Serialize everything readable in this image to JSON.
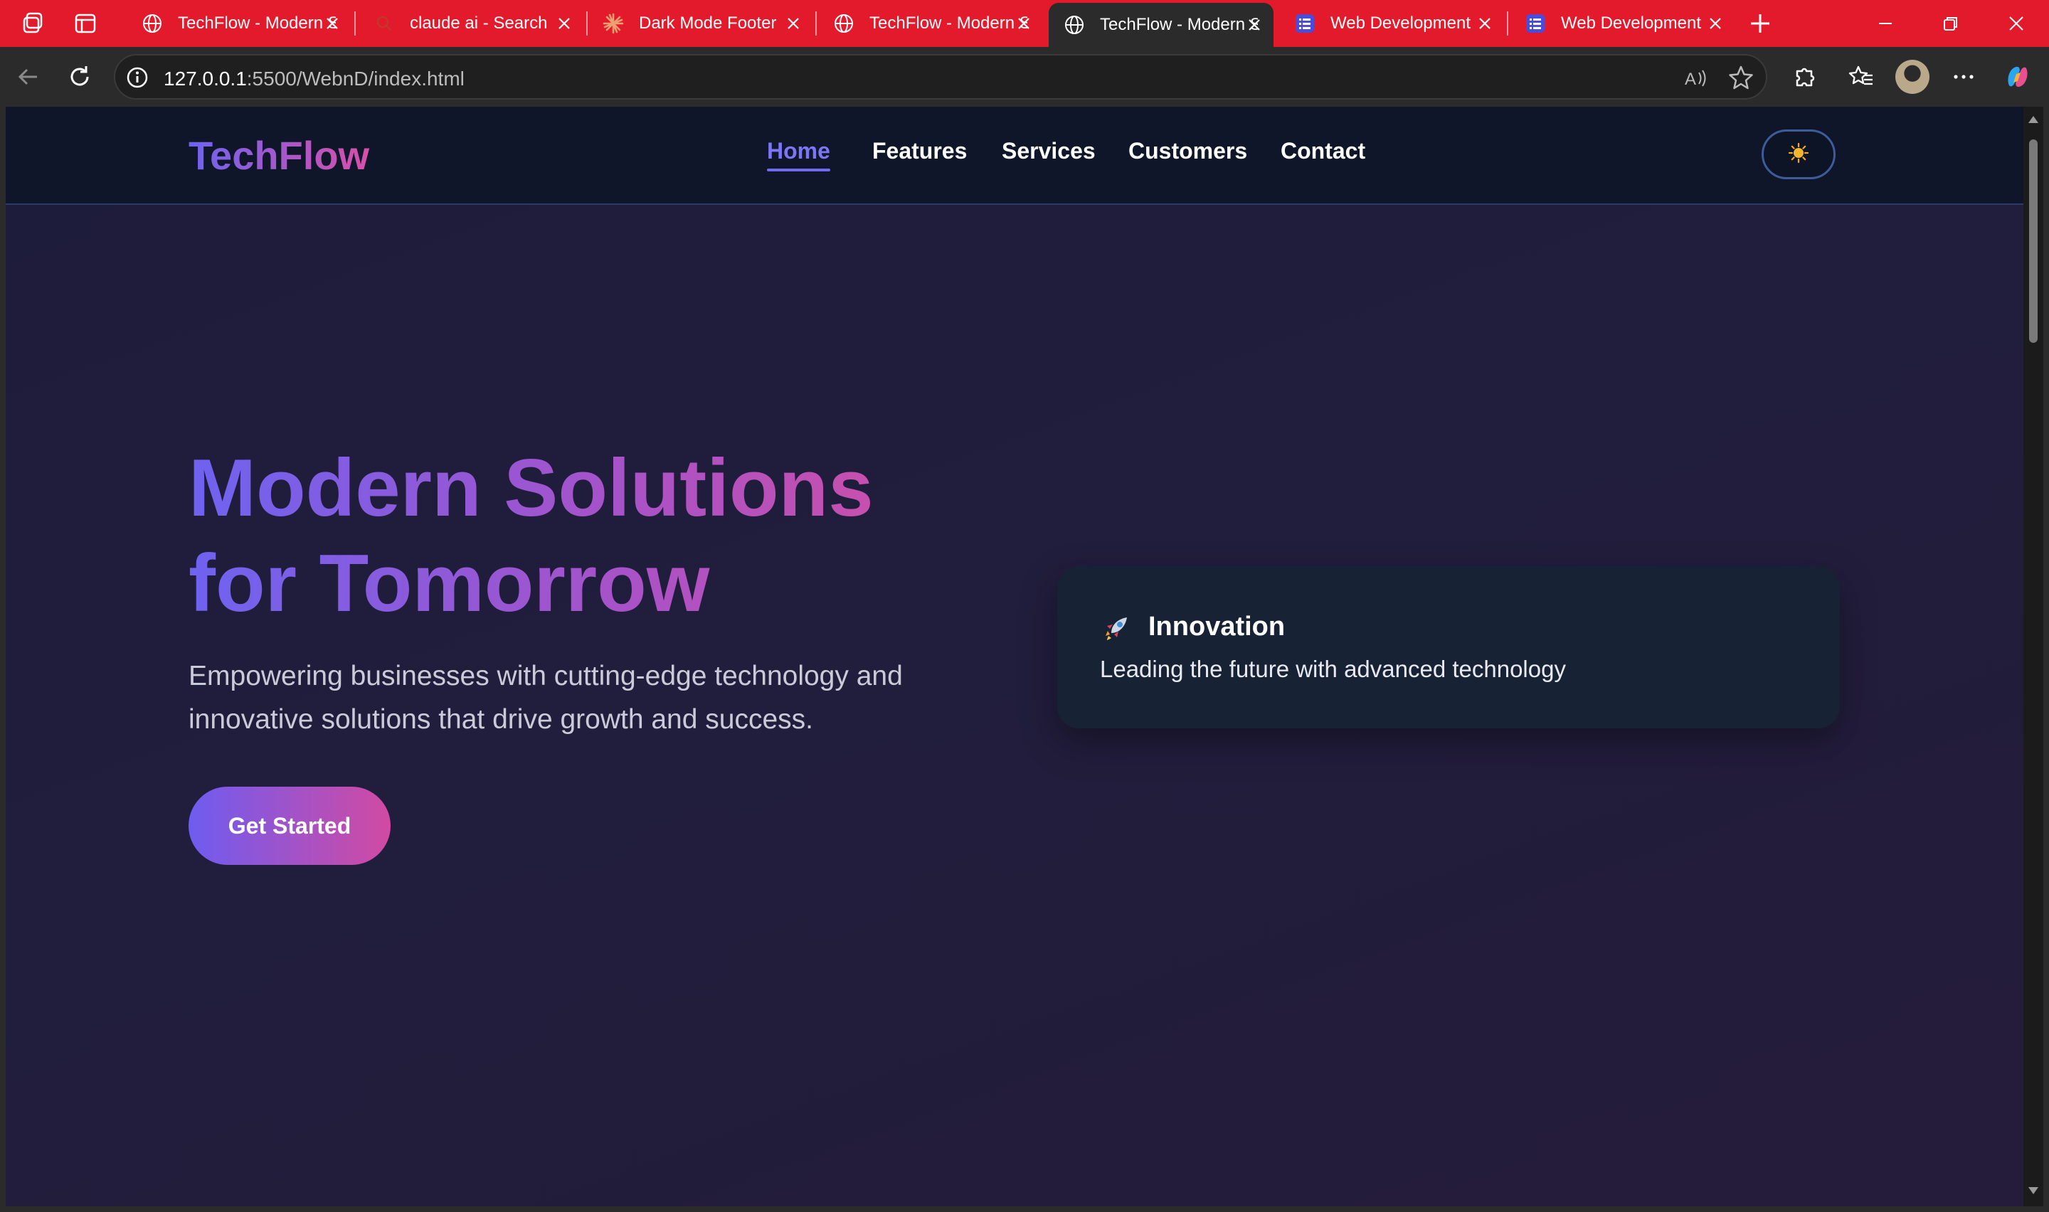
{
  "browser": {
    "tabs": [
      {
        "title": "TechFlow - Modern Solutions",
        "icon": "globe-icon",
        "active": false
      },
      {
        "title": "claude ai - Search",
        "icon": "search-icon",
        "active": false
      },
      {
        "title": "Dark Mode Footer",
        "icon": "claude-icon",
        "active": false
      },
      {
        "title": "TechFlow - Modern Solutions",
        "icon": "globe-icon",
        "active": false
      },
      {
        "title": "TechFlow - Modern Solutions",
        "icon": "globe-icon",
        "active": true
      },
      {
        "title": "Web Development",
        "icon": "list-icon",
        "active": false
      },
      {
        "title": "Web Development",
        "icon": "list-icon",
        "active": false
      }
    ],
    "url": {
      "host": "127.0.0.1",
      "rest": ":5500/WebnD/index.html"
    },
    "colors": {
      "tabstrip": "#e31a2b",
      "toolbar": "#2b2b2b"
    }
  },
  "site": {
    "logo": "TechFlow",
    "nav": [
      "Home",
      "Features",
      "Services",
      "Customers",
      "Contact"
    ],
    "active_nav": "Home",
    "theme_toggle_icon": "sun-icon",
    "hero": {
      "title": "Modern Solutions for Tomorrow",
      "subtitle": "Empowering businesses with cutting-edge technology and innovative solutions that drive growth and success.",
      "cta": "Get Started"
    },
    "card": {
      "icon": "rocket-icon",
      "title": "Innovation",
      "text": "Leading the future with advanced technology"
    },
    "colors": {
      "gradient_start": "#6e63f0",
      "gradient_end": "#d24fa4",
      "nav_bg": "#0f1629",
      "card_bg": "#182235"
    }
  }
}
